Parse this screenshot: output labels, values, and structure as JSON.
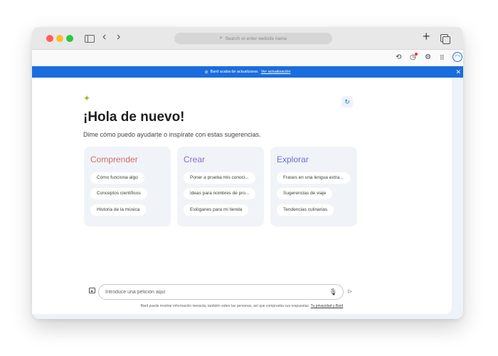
{
  "browser": {
    "address_placeholder": "Search or enter website name",
    "icons": {
      "sidebar": "sidebar-toggle-icon",
      "back": "‹",
      "forward": "›",
      "search": "⌕",
      "new_tab": "+",
      "history": "⟲",
      "timer": "◷",
      "settings": "⚙",
      "apps": "⠿",
      "avatar": "◠"
    }
  },
  "banner": {
    "text": "Bard acaba de actualizarse.",
    "link": "Ver actualización",
    "check": "⊘",
    "close": "✕",
    "color": "#1a6dde"
  },
  "main": {
    "sparkle": "✦",
    "refresh": "↻",
    "greeting": "¡Hola de nuevo!",
    "subtitle": "Dime cómo puedo ayudarte o inspírate con estas sugerencias.",
    "cards": [
      {
        "title": "Comprender",
        "color": "#d16d6a",
        "chips": [
          "Cómo funciona algo",
          "Conceptos científicos",
          "Historia de la música"
        ]
      },
      {
        "title": "Crear",
        "color": "#8d6fbf",
        "chips": [
          "Poner a prueba mis conoci...",
          "Ideas para nombres de pro...",
          "Eslóganes para mi tienda"
        ]
      },
      {
        "title": "Explorar",
        "color": "#6a72c7",
        "chips": [
          "Frases en una lengua extra...",
          "Sugerencias de viaje",
          "Tendencias culinarias"
        ]
      }
    ]
  },
  "input": {
    "placeholder": "Introduce una petición aquí",
    "mic": "🎙",
    "send": "⊳"
  },
  "footer": {
    "text": "Bard puede mostrar información inexacta, también sobre las personas, así que comprueba sus respuestas.",
    "link": "Tu privacidad y Bard"
  }
}
